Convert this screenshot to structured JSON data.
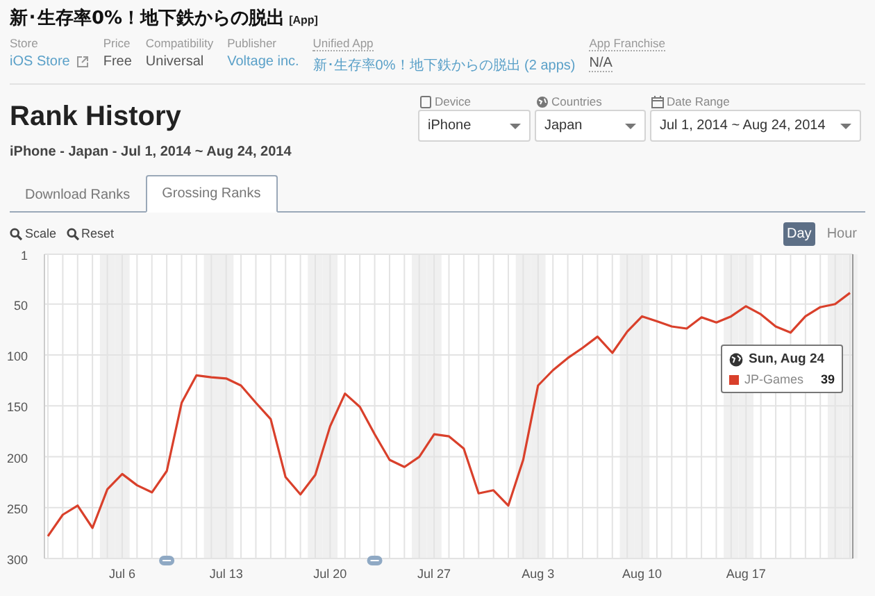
{
  "app": {
    "title": "新･生存率0%！地下鉄からの脱出",
    "badge": "[App]"
  },
  "meta": [
    {
      "label": "Store",
      "value": "iOS Store",
      "link": true,
      "external": true,
      "dotted": false
    },
    {
      "label": "Price",
      "value": "Free",
      "link": false,
      "external": false,
      "dotted": false
    },
    {
      "label": "Compatibility",
      "value": "Universal",
      "link": false,
      "external": false,
      "dotted": false
    },
    {
      "label": "Publisher",
      "value": "Voltage inc.",
      "link": true,
      "external": false,
      "dotted": false
    },
    {
      "label": "Unified App",
      "value": "新･生存率0%！地下鉄からの脱出 (2 apps)",
      "link": true,
      "external": false,
      "dotted": true
    },
    {
      "label": "App Franchise",
      "value": "N/A",
      "link": false,
      "external": false,
      "dotted": true
    }
  ],
  "page_title": "Rank History",
  "subtitle": "iPhone - Japan - Jul 1, 2014 ~ Aug 24, 2014",
  "filters": [
    {
      "kind": "device",
      "label": "Device",
      "value": "iPhone"
    },
    {
      "kind": "countries",
      "label": "Countries",
      "value": "Japan"
    },
    {
      "kind": "date",
      "label": "Date Range",
      "value": "Jul 1, 2014 ~ Aug 24, 2014"
    }
  ],
  "tabs": [
    {
      "label": "Download Ranks",
      "selected": false
    },
    {
      "label": "Grossing Ranks",
      "selected": true
    }
  ],
  "tools": [
    "Scale",
    "Reset"
  ],
  "granularity": [
    {
      "label": "Day",
      "selected": true
    },
    {
      "label": "Hour",
      "selected": false
    }
  ],
  "chart": {
    "chart_data": {
      "type": "line",
      "categories": [
        null,
        null,
        null,
        null,
        null,
        "Jul 6",
        null,
        null,
        null,
        null,
        null,
        null,
        "Jul 13",
        null,
        null,
        null,
        null,
        null,
        null,
        "Jul 20",
        null,
        null,
        null,
        null,
        null,
        null,
        "Jul 27",
        null,
        null,
        null,
        null,
        null,
        null,
        "Aug 3",
        null,
        null,
        null,
        null,
        null,
        null,
        "Aug 10",
        null,
        null,
        null,
        null,
        null,
        null,
        "Aug 17",
        null,
        null,
        null,
        null,
        null,
        null,
        null
      ],
      "grid": true,
      "series": [
        {
          "name": "JP-Games",
          "color": "#d9402b",
          "values": [
            278,
            257,
            248,
            270,
            232,
            217,
            228,
            235,
            214,
            147,
            120,
            122,
            123,
            130,
            147,
            163,
            220,
            237,
            218,
            170,
            138,
            151,
            178,
            203,
            210,
            200,
            178,
            180,
            192,
            236,
            233,
            248,
            203,
            130,
            115,
            103,
            93,
            82,
            98,
            77,
            62,
            67,
            72,
            74,
            63,
            68,
            62,
            52,
            60,
            72,
            78,
            62,
            53,
            50,
            39
          ]
        }
      ],
      "ylim": [
        300,
        1
      ],
      "yticks": [
        1,
        50,
        100,
        150,
        200,
        250,
        300
      ]
    },
    "tooltip": {
      "date": "Sun, Aug 24",
      "value": "39"
    }
  }
}
